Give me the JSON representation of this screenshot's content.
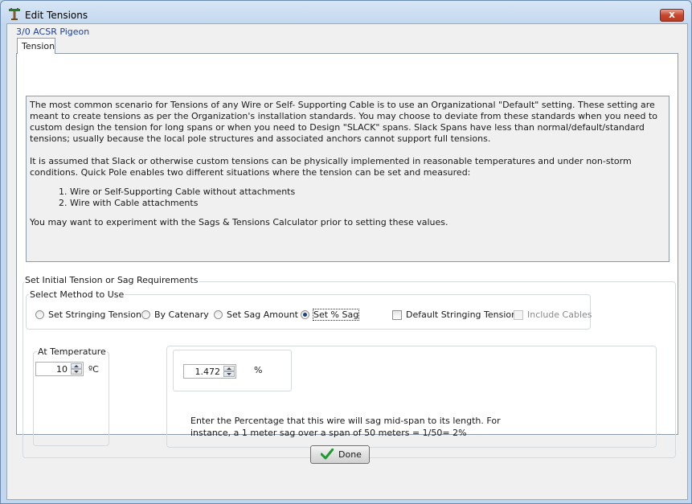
{
  "window": {
    "title": "Edit Tensions",
    "close_label": "x"
  },
  "cable_name": "3/0 ACSR Pigeon",
  "tabs": [
    {
      "label": "Tension"
    }
  ],
  "description": {
    "paragraph1": "The most common scenario for Tensions of any Wire or Self- Supporting Cable is to use an Organizational \"Default\" setting. These setting are meant to create tensions as per the Organization's installation standards. You may choose to deviate from these standards when you need to custom design the tension for long spans or when you need to Design \"SLACK\" spans. Slack Spans have less than normal/default/standard tensions; usually because the local pole structures and associated anchors cannot support full tensions.",
    "paragraph2": "It is assumed that Slack or otherwise custom tensions can be physically implemented in reasonable temperatures and under non-storm conditions. Quick Pole enables two different situations where the tension can be set and measured:",
    "list": [
      "Wire or Self-Supporting Cable without attachments",
      "Wire with Cable attachments"
    ],
    "paragraph3": "You may want to experiment with the Sags & Tensions Calculator prior to setting these values."
  },
  "requirements": {
    "group_label": "Set Initial Tension or Sag Requirements",
    "method_label": "Select Method to Use",
    "methods": [
      {
        "label": "Set Stringing Tension",
        "selected": false
      },
      {
        "label": "By Catenary",
        "selected": false
      },
      {
        "label": "Set Sag Amount",
        "selected": false
      },
      {
        "label": "Set % Sag",
        "selected": true
      }
    ],
    "default_stringing": {
      "label": "Default Stringing Tensions",
      "checked": false
    },
    "include_cables": {
      "label": "Include Cables",
      "checked": false,
      "enabled": false
    }
  },
  "temperature": {
    "group_label": "At Temperature",
    "value": "10",
    "unit": "ºC"
  },
  "sag": {
    "value": "1.472",
    "unit": "%",
    "help": "Enter the Percentage that this wire will sag mid-span to its length. For instance, a 1 meter sag over a span of 50 meters = 1/50= 2%"
  },
  "footer": {
    "done_label": "Done"
  },
  "colors": {
    "title_bar": "#c2d7ee",
    "link_blue": "#1c3f9e",
    "close_red": "#c8452d",
    "check_green": "#1e9a2e"
  }
}
